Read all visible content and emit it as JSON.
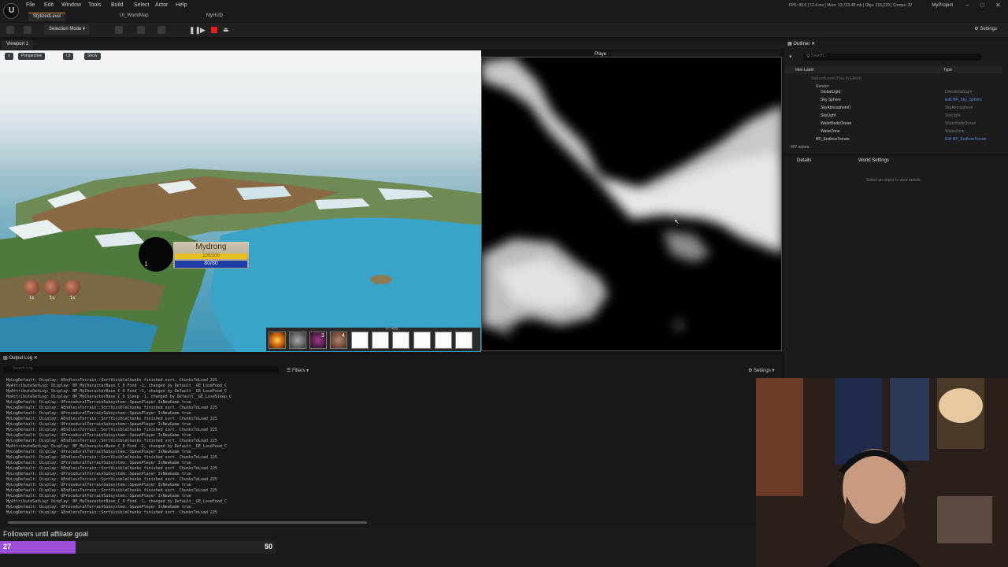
{
  "menubar": {
    "items": [
      "File",
      "Edit",
      "Window",
      "Tools",
      "Build",
      "Select",
      "Actor",
      "Help"
    ],
    "tabs": [
      "StylizedLevel",
      "UI_WorldMap",
      "MyHUD"
    ],
    "stats": "FPS: 80.6 | 12.4 ms | Mem: 13,723.48 mb | Objs: 215,229 | Comps: 32",
    "project": "MyProject"
  },
  "toolbar": {
    "selection_mode": "Selection Mode",
    "settings": "Settings"
  },
  "viewport": {
    "tab": "Viewport 1",
    "perspective": "Perspective",
    "lit": "Lit",
    "show": "Show",
    "play_label": "Playe"
  },
  "hud": {
    "level": "1",
    "name": "Mydrong",
    "hp_text": "100/100",
    "mp_text": "80/80",
    "status_times": [
      "1s",
      "1s",
      "1s"
    ],
    "hotbar_counts": [
      "3",
      "4"
    ],
    "hotbar_text": "0 / 400"
  },
  "outliner": {
    "tab": "Outliner",
    "search_placeholder": "Search...",
    "col_label": "Item Label",
    "col_type": "Type",
    "rows": [
      {
        "label": "StylizedLevel (Play In Editor)",
        "type": ""
      },
      {
        "label": "Render",
        "type": ""
      },
      {
        "label": "GlobalLight",
        "type": "DirectionalLight"
      },
      {
        "label": "Sky Sphere",
        "type": "Edit BP_Sky_Sphere"
      },
      {
        "label": "SkyAtmosphere0",
        "type": "SkyAtmosphere"
      },
      {
        "label": "SkyLight",
        "type": "SkyLight"
      },
      {
        "label": "WaterBodyOcean",
        "type": "WaterBodyOcean"
      },
      {
        "label": "WaterZone",
        "type": "WaterZone"
      },
      {
        "label": "BP_EndlessTerrain",
        "type": "Edit BP_EndlessTerrain"
      }
    ],
    "actor_count": "607 actors"
  },
  "details": {
    "tab": "Details",
    "world_settings_tab": "World Settings",
    "empty_text": "Select an object to view details."
  },
  "outputlog": {
    "tab": "Output Log",
    "search_placeholder": "Search Log",
    "filters": "Filters",
    "settings": "Settings",
    "lines": [
      "MyLogDefault: Display: AEndlessTerrain::SortVisibleChunks finished sort. ChunksToLoad 225",
      "MyAttributeSetLog: Display: BP_MyCharacterBase_C_0 Food -1, changed by Default__GE_LoseFood_C",
      "MyAttributeSetLog: Display: BP_MyCharacterBase_C_0 Food -1, changed by Default__GE_LoseFood_C",
      "MyAttributeSetLog: Display: BP_MyCharacterBase_C_0 Sleep -1, changed by Default__GE_LoseSleep_C",
      "MyLogDefault: Display: UProceduralTerrainSubsystem::SpawnPlayer IsNewGame true",
      "MyLogDefault: Display: AEndlessTerrain::SortVisibleChunks finished sort. ChunksToLoad 225",
      "MyLogDefault: Display: UProceduralTerrainSubsystem::SpawnPlayer IsNewGame true",
      "MyLogDefault: Display: AEndlessTerrain::SortVisibleChunks finished sort. ChunksToLoad 225",
      "MyLogDefault: Display: UProceduralTerrainSubsystem::SpawnPlayer IsNewGame true",
      "MyLogDefault: Display: AEndlessTerrain::SortVisibleChunks finished sort. ChunksToLoad 225",
      "MyLogDefault: Display: UProceduralTerrainSubsystem::SpawnPlayer IsNewGame true",
      "MyLogDefault: Display: AEndlessTerrain::SortVisibleChunks finished sort. ChunksToLoad 225",
      "MyAttributeSetLog: Display: BP_MyCharacterBase_C_0 Food -1, changed by Default__GE_LoseFood_C",
      "MyLogDefault: Display: UProceduralTerrainSubsystem::SpawnPlayer IsNewGame true",
      "MyLogDefault: Display: AEndlessTerrain::SortVisibleChunks finished sort. ChunksToLoad 225",
      "MyLogDefault: Display: UProceduralTerrainSubsystem::SpawnPlayer IsNewGame true",
      "MyLogDefault: Display: AEndlessTerrain::SortVisibleChunks finished sort. ChunksToLoad 225",
      "MyLogDefault: Display: UProceduralTerrainSubsystem::SpawnPlayer IsNewGame true",
      "MyLogDefault: Display: AEndlessTerrain::SortVisibleChunks finished sort. ChunksToLoad 225",
      "MyLogDefault: Display: UProceduralTerrainSubsystem::SpawnPlayer IsNewGame true",
      "MyLogDefault: Display: AEndlessTerrain::SortVisibleChunks finished sort. ChunksToLoad 225",
      "MyLogDefault: Display: UProceduralTerrainSubsystem::SpawnPlayer IsNewGame true",
      "MyAttributeSetLog: Display: BP_MyCharacterBase_C_0 Food -1, changed by Default__GE_LoseFood_C",
      "MyLogDefault: Display: UProceduralTerrainSubsystem::SpawnPlayer IsNewGame true",
      "MyLogDefault: Display: AEndlessTerrain::SortVisibleChunks finished sort. ChunksToLoad 225"
    ]
  },
  "goal": {
    "title": "Followers until affiliate goal",
    "current": "27",
    "target": "50",
    "progress_fraction": 0.54,
    "fill_color": "#9b4fd6"
  },
  "icons": [
    "unreal-logo-icon",
    "save-icon",
    "content-icon",
    "play-icon",
    "pause-icon",
    "stop-icon",
    "settings-icon",
    "search-icon",
    "eye-icon",
    "close-icon"
  ]
}
